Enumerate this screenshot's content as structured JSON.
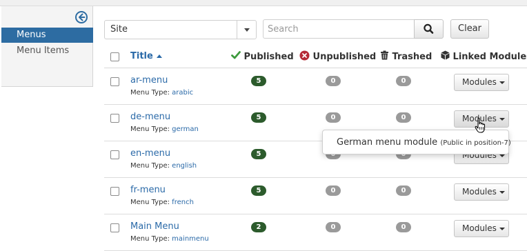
{
  "sidebar": {
    "items": [
      {
        "label": "Menus",
        "active": true
      },
      {
        "label": "Menu Items",
        "active": false
      }
    ]
  },
  "filters": {
    "client_select": "Site",
    "search_placeholder": "Search",
    "search_value": "",
    "clear_label": "Clear"
  },
  "table": {
    "headers": {
      "title": "Title",
      "published": "Published",
      "unpublished": "Unpublished",
      "trashed": "Trashed",
      "linked_modules": "Linked Modules"
    },
    "type_prefix": "Menu Type:",
    "modules_label": "Modules",
    "rows": [
      {
        "title": "ar-menu",
        "menu_type": "arabic",
        "published": "5",
        "unpublished": "0",
        "trashed": "0"
      },
      {
        "title": "de-menu",
        "menu_type": "german",
        "published": "5",
        "unpublished": "0",
        "trashed": "0"
      },
      {
        "title": "en-menu",
        "menu_type": "english",
        "published": "5",
        "unpublished": "0",
        "trashed": "0"
      },
      {
        "title": "fr-menu",
        "menu_type": "french",
        "published": "5",
        "unpublished": "0",
        "trashed": "0"
      },
      {
        "title": "Main Menu",
        "menu_type": "mainmenu",
        "published": "2",
        "unpublished": "0",
        "trashed": "0"
      }
    ]
  },
  "modules_dropdown": {
    "item_name": "German menu module",
    "item_detail": "(Public in position-7)"
  },
  "colors": {
    "accent": "#2d6ca2",
    "link": "#2b6aa8",
    "published_badge": "#2c5b2c",
    "zero_badge": "#9a9a9a",
    "published_icon": "#3c9a3c",
    "unpublished_icon": "#b52b37"
  },
  "icons": {
    "collapse": "arrow-left-circle-icon",
    "search": "search-icon",
    "published": "check-icon",
    "unpublished": "x-circle-icon",
    "trashed": "trash-icon",
    "linked": "cube-icon"
  }
}
